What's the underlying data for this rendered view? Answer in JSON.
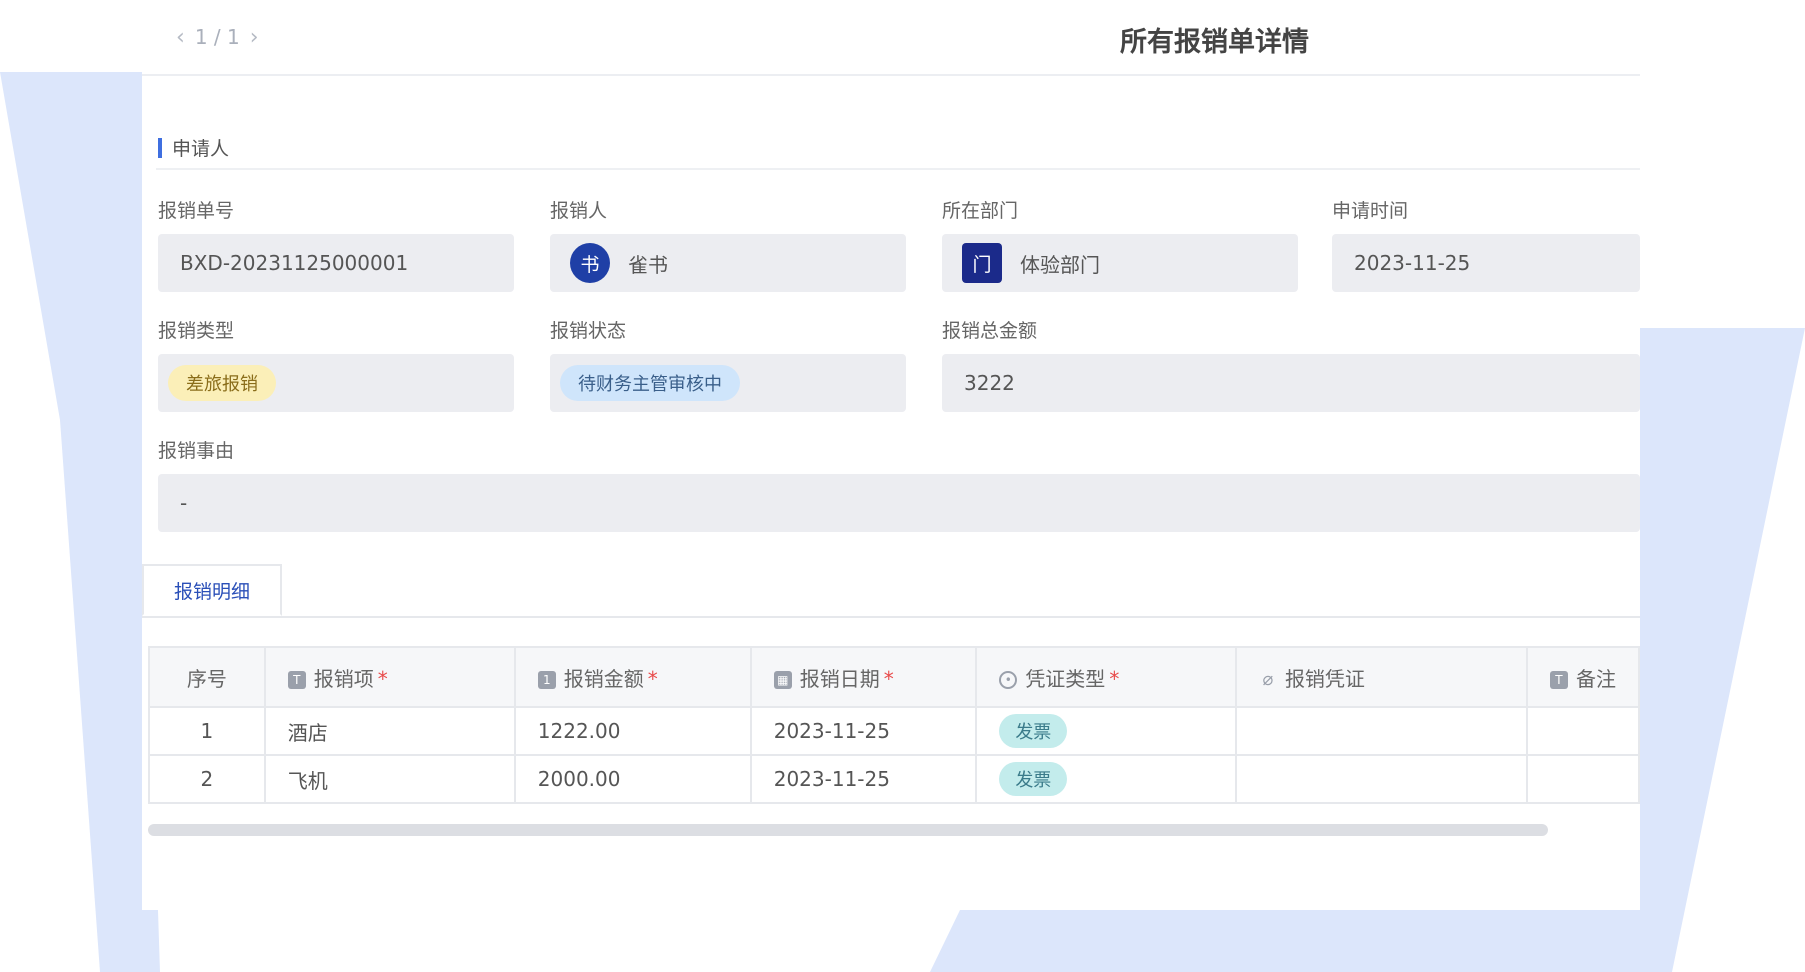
{
  "pager": {
    "prev_icon": "chevron-left-icon",
    "text": "1 / 1",
    "next_icon": "chevron-right-icon"
  },
  "page_title": "所有报销单详情",
  "section": {
    "title": "申请人"
  },
  "fields": {
    "order_no": {
      "label": "报销单号",
      "value": "BXD-20231125000001"
    },
    "applicant": {
      "label": "报销人",
      "avatar": "书",
      "value": "雀书"
    },
    "department": {
      "label": "所在部门",
      "icon": "门",
      "value": "体验部门"
    },
    "apply_time": {
      "label": "申请时间",
      "value": "2023-11-25"
    },
    "type": {
      "label": "报销类型",
      "value": "差旅报销"
    },
    "status": {
      "label": "报销状态",
      "value": "待财务主管审核中"
    },
    "total": {
      "label": "报销总金额",
      "value": "3222"
    },
    "reason": {
      "label": "报销事由",
      "value": "-"
    }
  },
  "tabs": [
    {
      "label": "报销明细"
    }
  ],
  "table": {
    "columns": [
      "序号",
      "报销项",
      "报销金额",
      "报销日期",
      "凭证类型",
      "报销凭证",
      "备注"
    ],
    "rows": [
      {
        "seq": "1",
        "item": "酒店",
        "amount": "1222.00",
        "date": "2023-11-25",
        "voucher_type": "发票",
        "voucher": "",
        "note": ""
      },
      {
        "seq": "2",
        "item": "飞机",
        "amount": "2000.00",
        "date": "2023-11-25",
        "voucher_type": "发票",
        "voucher": "",
        "note": ""
      }
    ]
  },
  "colors": {
    "accent": "#3f6fe0",
    "decor": "#dce6fb"
  }
}
